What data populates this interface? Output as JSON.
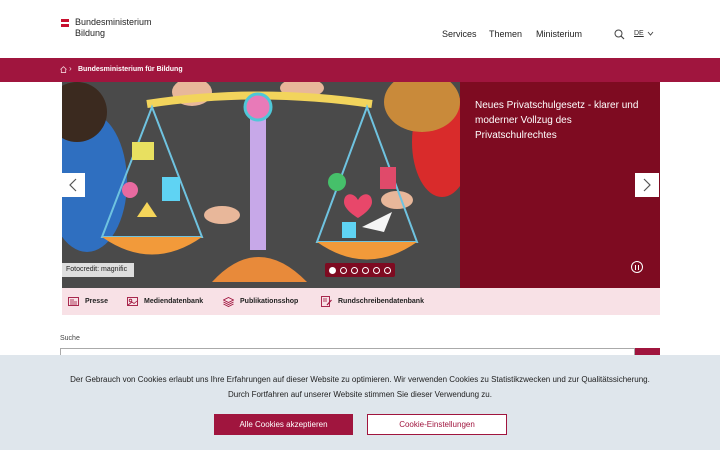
{
  "brand": {
    "line1": "Bundesministerium",
    "line2": "Bildung",
    "flag_colors": [
      "#c8102e",
      "#ffffff",
      "#c8102e"
    ]
  },
  "nav": {
    "items": [
      "Services",
      "Themen",
      "Ministerium"
    ],
    "search_icon": "search-icon",
    "language": "DE"
  },
  "breadcrumb": {
    "home_icon": "home-icon",
    "current": "Bundesministerium für Bildung"
  },
  "hero": {
    "title": "Neues Privatschulgesetz - klarer und moderner Vollzug des Privatschulrechtes",
    "credit": "Fotocredit: magnific",
    "slide_count": 6,
    "active_slide": 1,
    "prev_icon": "chevron-left-icon",
    "next_icon": "chevron-right-icon",
    "pause_icon": "pause-icon"
  },
  "quick_links": [
    {
      "label": "Presse",
      "icon": "newspaper-icon"
    },
    {
      "label": "Mediendatenbank",
      "icon": "image-icon"
    },
    {
      "label": "Publikationsshop",
      "icon": "book-icon"
    },
    {
      "label": "Rundschreibendatenbank",
      "icon": "document-edit-icon"
    }
  ],
  "search": {
    "label": "Suche"
  },
  "cookie": {
    "text_line1": "Der Gebrauch von Cookies erlaubt uns Ihre Erfahrungen auf dieser Website zu optimieren. Wir verwenden Cookies zu Statistikzwecken und zur Qualitätssicherung.",
    "text_line2": "Durch Fortfahren auf unserer Website stimmen Sie dieser Verwendung zu.",
    "accept_label": "Alle Cookies akzeptieren",
    "settings_label": "Cookie-Einstellungen"
  },
  "colors": {
    "primary": "#a0153e",
    "hero_panel": "#7e0b21",
    "quick_bg": "#f8e1e6",
    "cookie_bg": "#dfe6ec"
  }
}
